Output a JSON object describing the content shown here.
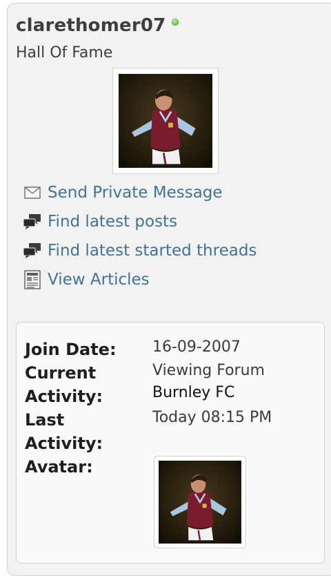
{
  "profile": {
    "username": "clarethomer07",
    "online": true,
    "user_title": "Hall Of Fame",
    "avatar_icon": "avatar-photo"
  },
  "actions": [
    {
      "label": "Send Private Message",
      "icon": "envelope-icon"
    },
    {
      "label": "Find latest posts",
      "icon": "posts-icon"
    },
    {
      "label": "Find latest started threads",
      "icon": "threads-icon"
    },
    {
      "label": "View Articles",
      "icon": "articles-icon"
    }
  ],
  "details": {
    "join_date_label": "Join Date:",
    "join_date": "16-09-2007",
    "current_activity_label": "Current Activity:",
    "current_activity_prefix": "Viewing Forum",
    "current_activity_link": "Burnley FC",
    "last_activity_label": "Last Activity:",
    "last_activity": "Today 08:15 PM",
    "avatar_label": "Avatar:"
  },
  "colors": {
    "link": "#417394",
    "online": "#6cbf4a",
    "panel_bg": "#f2f2f2"
  }
}
